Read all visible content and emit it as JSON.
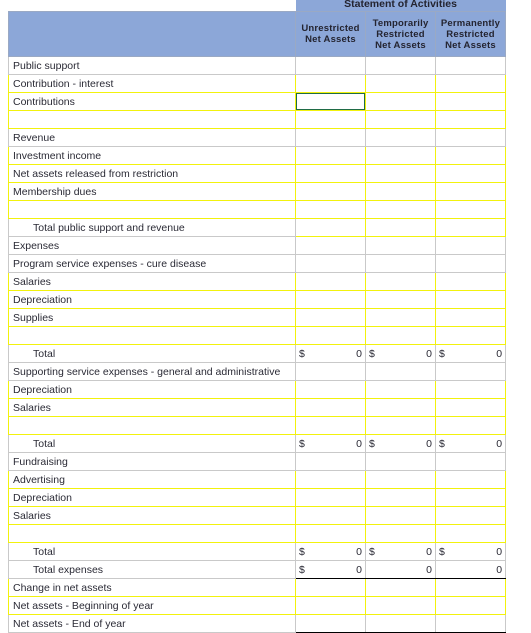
{
  "document": {
    "title": "Statement of Activities",
    "accent_header_color": "#8ca7d8",
    "input_border_color": "#f2f20d",
    "selected_border_color": "#1f6b46",
    "grid_color": "#c9c9c9"
  },
  "columns": {
    "label_header": "",
    "headers": [
      "Unrestricted Net Assets",
      "Temporarily Restricted Net Assets",
      "Permanently Restricted Net Assets"
    ],
    "headers_lines": [
      [
        "Unrestricted",
        "Net Assets"
      ],
      [
        "Temporarily",
        "Restricted",
        "Net Assets"
      ],
      [
        "Permanently",
        "Restricted",
        "Net Assets"
      ]
    ]
  },
  "selected_cell": {
    "row_label": "Contributions",
    "column": "Unrestricted Net Assets"
  },
  "rows": [
    {
      "label": "Public support",
      "kind": "section",
      "values": [
        "",
        "",
        ""
      ]
    },
    {
      "label": "Contribution - interest",
      "kind": "input",
      "values": [
        "",
        "",
        ""
      ]
    },
    {
      "label": "Contributions",
      "kind": "input",
      "values": [
        "",
        "",
        ""
      ],
      "selected_col": 0
    },
    {
      "label": "",
      "kind": "spacer",
      "values": [
        "",
        "",
        ""
      ]
    },
    {
      "label": "Revenue",
      "kind": "section",
      "values": [
        "",
        "",
        ""
      ]
    },
    {
      "label": "Investment income",
      "kind": "input",
      "values": [
        "",
        "",
        ""
      ]
    },
    {
      "label": "Net assets released from restriction",
      "kind": "input",
      "values": [
        "",
        "",
        ""
      ]
    },
    {
      "label": "Membership dues",
      "kind": "input",
      "values": [
        "",
        "",
        ""
      ]
    },
    {
      "label": "",
      "kind": "spacer",
      "values": [
        "",
        "",
        ""
      ],
      "bottom_rule": true
    },
    {
      "label": "Total public support and revenue",
      "kind": "total-input",
      "indent": true,
      "values": [
        "",
        "",
        ""
      ]
    },
    {
      "label": "Expenses",
      "kind": "section",
      "values": [
        "",
        "",
        ""
      ]
    },
    {
      "label": "Program service expenses - cure disease",
      "kind": "section",
      "values": [
        "",
        "",
        ""
      ]
    },
    {
      "label": "Salaries",
      "kind": "input",
      "values": [
        "",
        "",
        ""
      ]
    },
    {
      "label": "Depreciation",
      "kind": "input",
      "values": [
        "",
        "",
        ""
      ]
    },
    {
      "label": "Supplies",
      "kind": "input",
      "values": [
        "",
        "",
        ""
      ]
    },
    {
      "label": "",
      "kind": "spacer",
      "values": [
        "",
        "",
        ""
      ],
      "bottom_rule": true
    },
    {
      "label": "Total",
      "kind": "total",
      "indent": true,
      "currency": [
        true,
        true,
        true
      ],
      "values": [
        "0",
        "0",
        "0"
      ]
    },
    {
      "label": "Supporting service expenses - general and administrative",
      "kind": "section",
      "values": [
        "",
        "",
        ""
      ]
    },
    {
      "label": "Depreciation",
      "kind": "input",
      "values": [
        "",
        "",
        ""
      ]
    },
    {
      "label": "Salaries",
      "kind": "input",
      "values": [
        "",
        "",
        ""
      ]
    },
    {
      "label": "",
      "kind": "spacer",
      "values": [
        "",
        "",
        ""
      ],
      "bottom_rule": true
    },
    {
      "label": "Total",
      "kind": "total",
      "indent": true,
      "currency": [
        true,
        true,
        true
      ],
      "values": [
        "0",
        "0",
        "0"
      ]
    },
    {
      "label": "Fundraising",
      "kind": "section",
      "values": [
        "",
        "",
        ""
      ]
    },
    {
      "label": "Advertising",
      "kind": "input",
      "values": [
        "",
        "",
        ""
      ]
    },
    {
      "label": "Depreciation",
      "kind": "input",
      "values": [
        "",
        "",
        ""
      ]
    },
    {
      "label": "Salaries",
      "kind": "input",
      "values": [
        "",
        "",
        ""
      ]
    },
    {
      "label": "",
      "kind": "spacer",
      "values": [
        "",
        "",
        ""
      ],
      "bottom_rule": true
    },
    {
      "label": "Total",
      "kind": "total",
      "indent": true,
      "currency": [
        true,
        true,
        true
      ],
      "values": [
        "0",
        "0",
        "0"
      ]
    },
    {
      "label": "Total expenses",
      "kind": "total",
      "indent": true,
      "currency": [
        true,
        false,
        false
      ],
      "values": [
        "0",
        "0",
        "0"
      ],
      "bottom_rule": true
    },
    {
      "label": "Change in net assets",
      "kind": "input",
      "values": [
        "",
        "",
        ""
      ]
    },
    {
      "label": "Net assets - Beginning of year",
      "kind": "input",
      "values": [
        "",
        "",
        ""
      ],
      "bottom_rule": true
    },
    {
      "label": "Net assets - End of year",
      "kind": "section",
      "values": [
        "",
        "",
        ""
      ],
      "bottom_rule": true
    }
  ]
}
